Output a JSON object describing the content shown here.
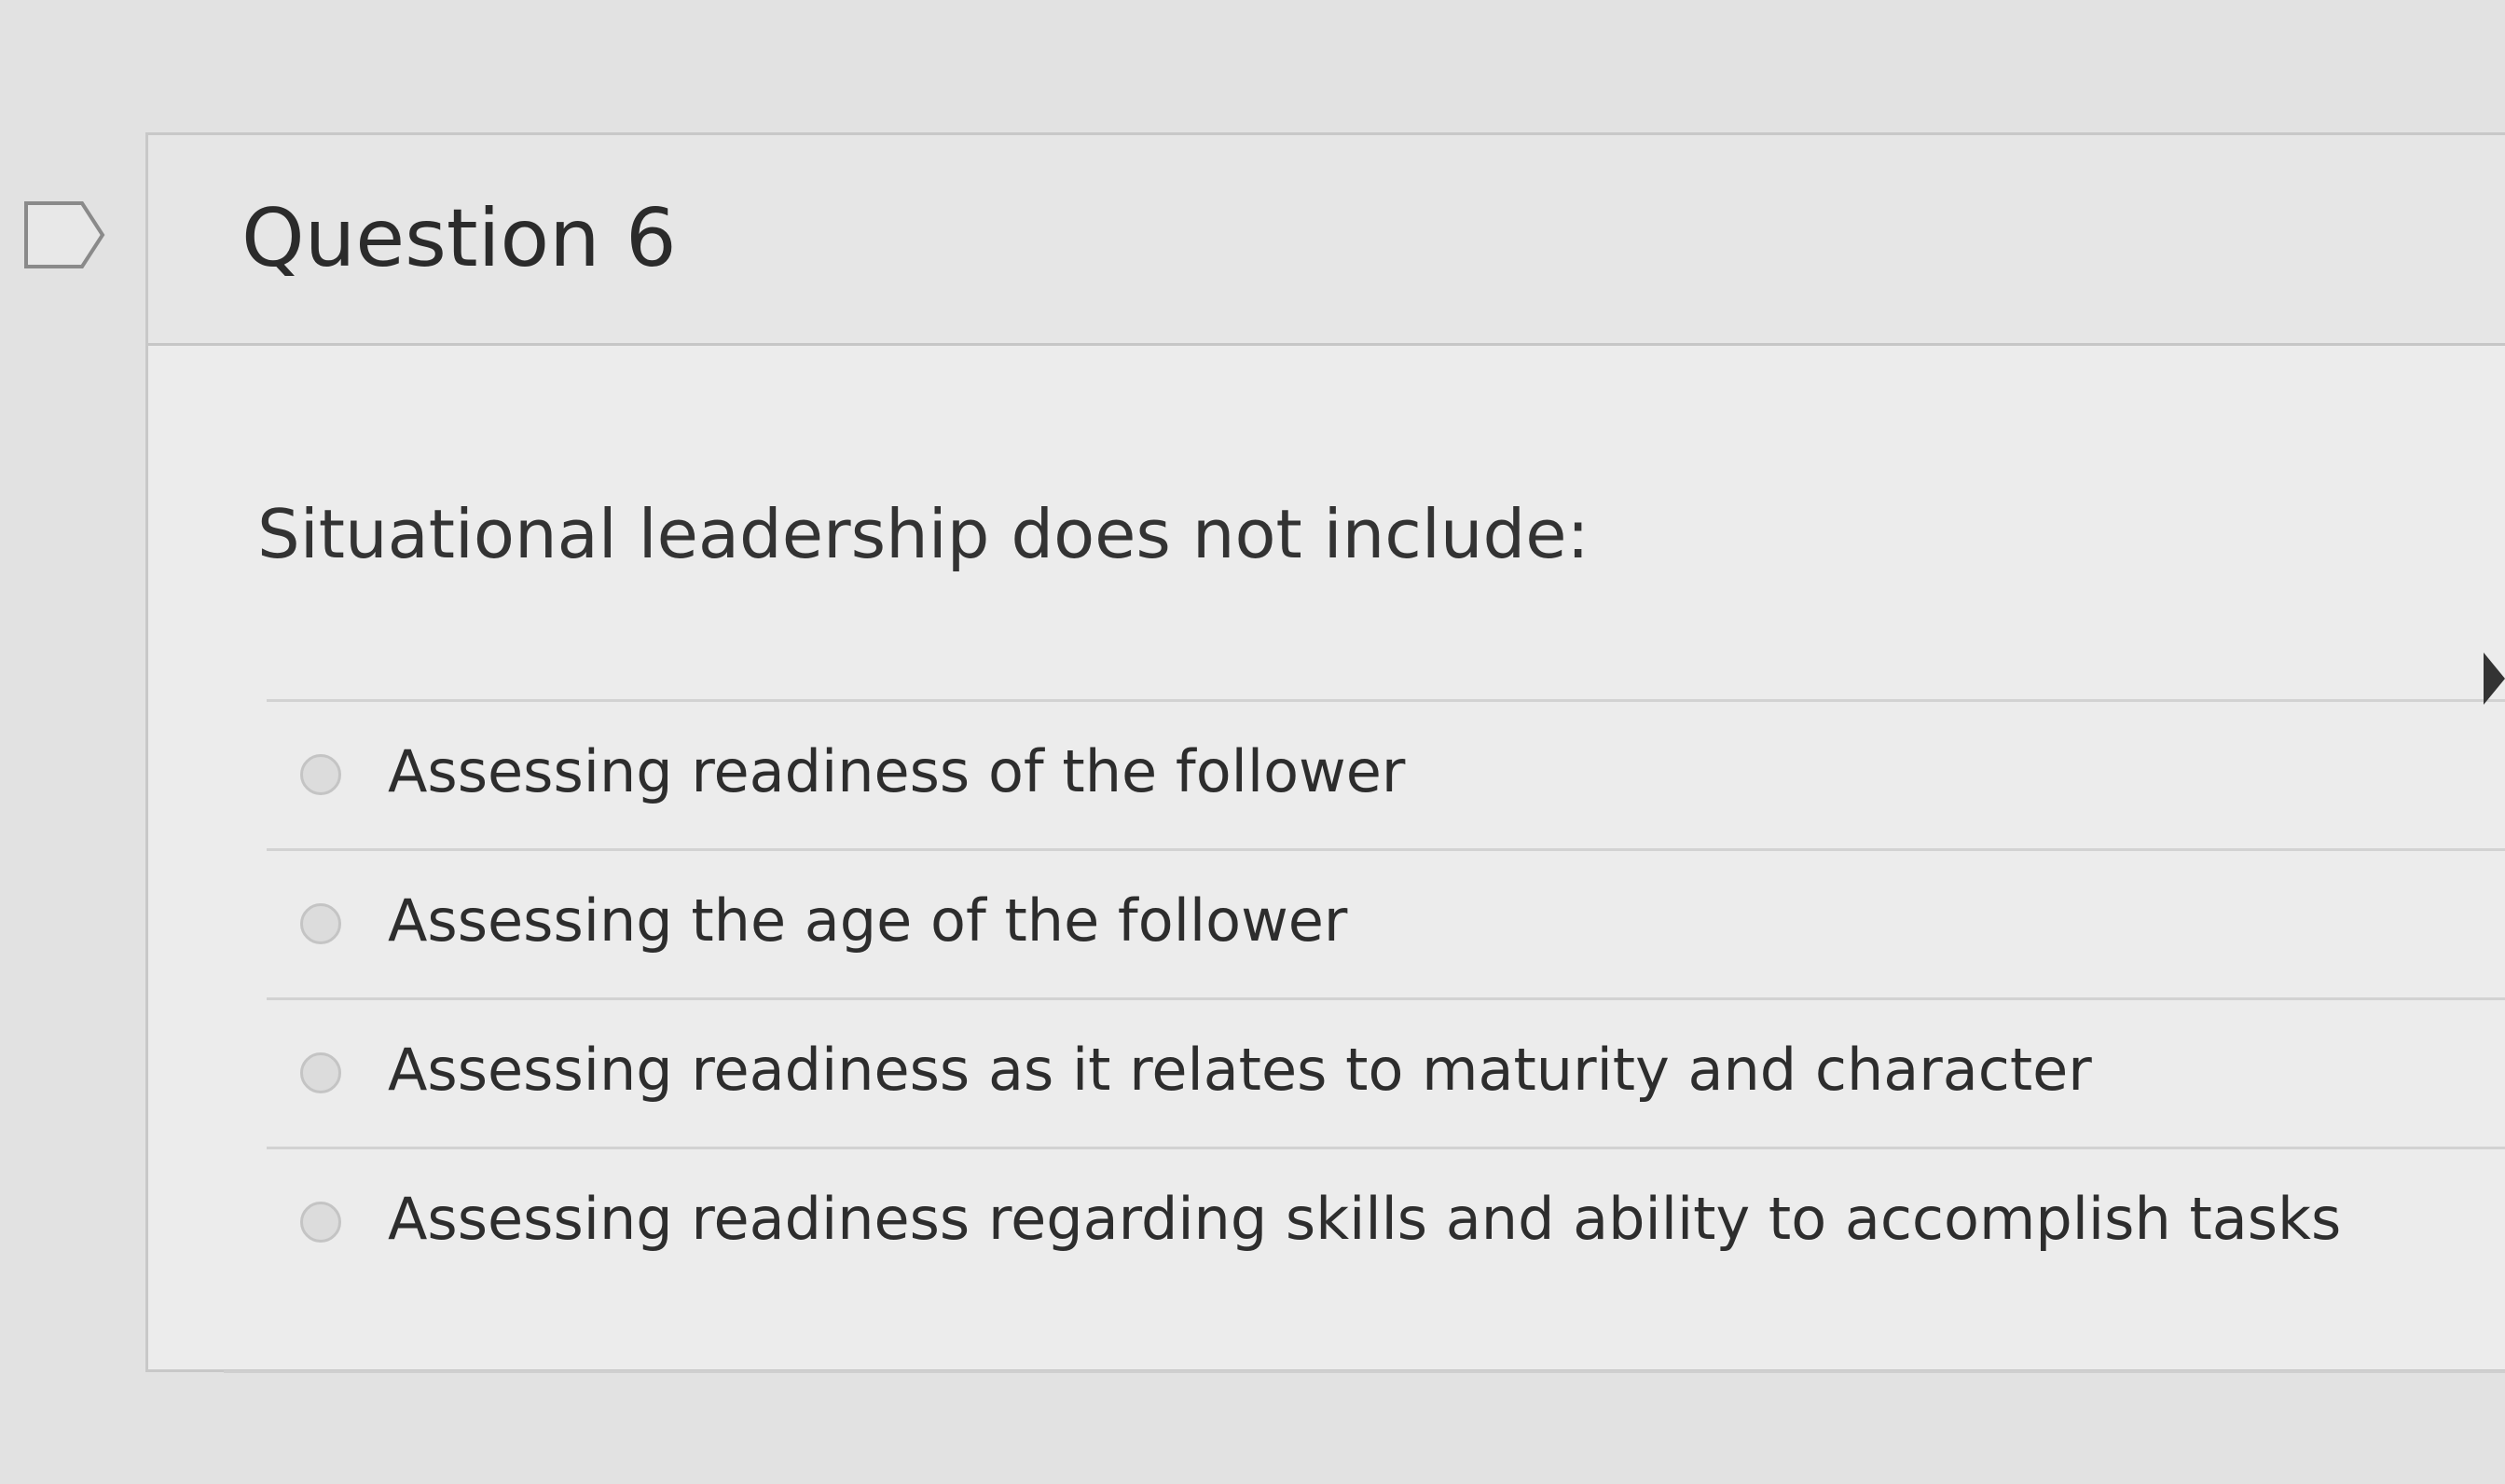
{
  "question": {
    "title": "Question 6",
    "text": "Situational leadership does not include:",
    "answers": [
      {
        "label": "Assessing readiness of the follower",
        "selected": false
      },
      {
        "label": "Assessing the age of the follower",
        "selected": false
      },
      {
        "label": "Assessing readiness as it relates to maturity and character",
        "selected": false
      },
      {
        "label": "Assessing readiness regarding skills and ability to accomplish tasks",
        "selected": false
      }
    ]
  },
  "icons": {
    "flag": "flag-icon",
    "radio": "radio-button-icon",
    "cursor": "mouse-cursor-icon"
  }
}
